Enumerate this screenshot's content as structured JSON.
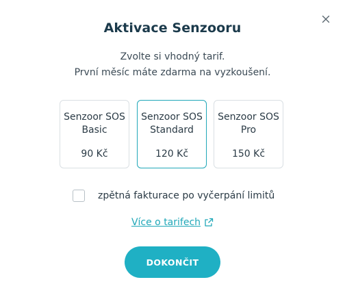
{
  "dialog": {
    "title": "Aktivace Senzooru",
    "close_icon": "close-icon",
    "subtitle_line1": "Zvolte si vhodný tarif.",
    "subtitle_line2": "První měsíc máte zdarma na vyzkoušení."
  },
  "plans": [
    {
      "name_line1": "Senzoor SOS",
      "name_line2": "Basic",
      "price": "90 Kč",
      "selected": false
    },
    {
      "name_line1": "Senzoor SOS",
      "name_line2": "Standard",
      "price": "120 Kč",
      "selected": true
    },
    {
      "name_line1": "Senzoor SOS",
      "name_line2": "Pro",
      "price": "150 Kč",
      "selected": false
    }
  ],
  "billing_checkbox": {
    "label": "zpětná fakturace po vyčerpání limitů",
    "checked": false
  },
  "more_link": {
    "label": "Více o tarifech",
    "icon": "external-link-icon"
  },
  "finish_button": {
    "label": "DOKONČIT"
  },
  "colors": {
    "accent": "#1fb0c4",
    "link": "#1fa7b8",
    "title": "#1b3a4b",
    "card_border": "#d9dfe3"
  }
}
